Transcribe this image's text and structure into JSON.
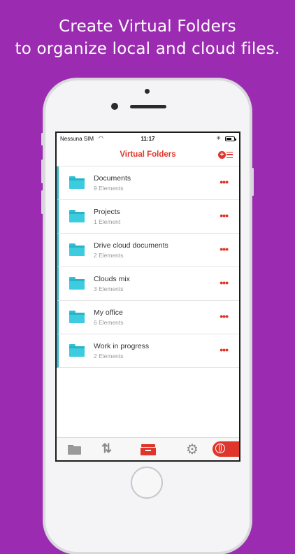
{
  "headline": {
    "line1": "Create Virtual Folders",
    "line2": "to organize local and cloud files."
  },
  "status_bar": {
    "carrier": "Nessuna SIM",
    "time": "11:17",
    "battery_level": 0.7
  },
  "nav": {
    "title": "Virtual Folders",
    "add_icon": "add-folder-icon",
    "accent_color": "#e0352a"
  },
  "folders": [
    {
      "name": "Documents",
      "count": "9 Elements"
    },
    {
      "name": "Projects",
      "count": "1 Element"
    },
    {
      "name": "Drive cloud documents",
      "count": "2 Elements"
    },
    {
      "name": "Clouds mix",
      "count": "3 Elements"
    },
    {
      "name": "My office",
      "count": "6 Elements"
    },
    {
      "name": "Work in progress",
      "count": "2 Elements"
    }
  ],
  "more_label": "•••",
  "tab_bar": {
    "tabs": [
      "folder-icon",
      "transfer-icon",
      "inbox-icon",
      "gear-icon",
      "globe-icon"
    ],
    "selected": "inbox-icon"
  },
  "colors": {
    "background": "#9b2bb0",
    "folder": "#3dcbe0",
    "row_accent": "#3db8c6"
  }
}
